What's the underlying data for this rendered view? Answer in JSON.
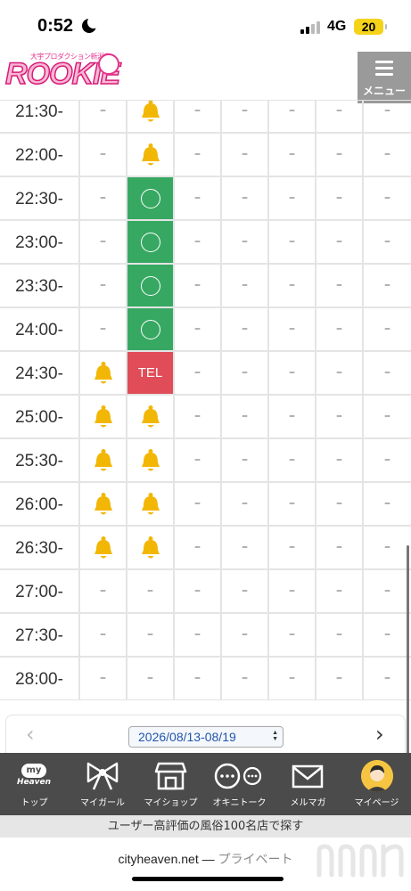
{
  "status_bar": {
    "time": "0:52",
    "network": "4G",
    "battery": "20"
  },
  "header": {
    "logo_text": "ROOKIE",
    "logo_sub": "大宇プロダクション新潟店",
    "menu_label": "メニュー"
  },
  "schedule": {
    "rows": [
      {
        "time": "21:30-",
        "cells": [
          "dash",
          "bell",
          "dash",
          "dash",
          "dash",
          "dash",
          "dash"
        ]
      },
      {
        "time": "22:00-",
        "cells": [
          "dash",
          "bell",
          "dash",
          "dash",
          "dash",
          "dash",
          "dash"
        ]
      },
      {
        "time": "22:30-",
        "cells": [
          "dash",
          "ok",
          "dash",
          "dash",
          "dash",
          "dash",
          "dash"
        ]
      },
      {
        "time": "23:00-",
        "cells": [
          "dash",
          "ok",
          "dash",
          "dash",
          "dash",
          "dash",
          "dash"
        ]
      },
      {
        "time": "23:30-",
        "cells": [
          "dash",
          "ok",
          "dash",
          "dash",
          "dash",
          "dash",
          "dash"
        ]
      },
      {
        "time": "24:00-",
        "cells": [
          "dash",
          "ok",
          "dash",
          "dash",
          "dash",
          "dash",
          "dash"
        ]
      },
      {
        "time": "24:30-",
        "cells": [
          "bell",
          "tel",
          "dash",
          "dash",
          "dash",
          "dash",
          "dash"
        ]
      },
      {
        "time": "25:00-",
        "cells": [
          "bell",
          "bell",
          "dash",
          "dash",
          "dash",
          "dash",
          "dash"
        ]
      },
      {
        "time": "25:30-",
        "cells": [
          "bell",
          "bell",
          "dash",
          "dash",
          "dash",
          "dash",
          "dash"
        ]
      },
      {
        "time": "26:00-",
        "cells": [
          "bell",
          "bell",
          "dash",
          "dash",
          "dash",
          "dash",
          "dash"
        ]
      },
      {
        "time": "26:30-",
        "cells": [
          "bell",
          "bell",
          "dash",
          "dash",
          "dash",
          "dash",
          "dash"
        ]
      },
      {
        "time": "27:00-",
        "cells": [
          "dash",
          "dash",
          "dash",
          "dash",
          "dash",
          "dash",
          "dash"
        ]
      },
      {
        "time": "27:30-",
        "cells": [
          "dash",
          "dash",
          "dash",
          "dash",
          "dash",
          "dash",
          "dash"
        ]
      },
      {
        "time": "28:00-",
        "cells": [
          "dash",
          "dash",
          "dash",
          "dash",
          "dash",
          "dash",
          "dash"
        ]
      }
    ],
    "dash_text": "–",
    "tel_text": "TEL",
    "icons": {
      "dash": "dash",
      "bell": "bell-icon",
      "ok": "circle-icon",
      "tel": "tel-label"
    },
    "colors": {
      "ok": "#37a862",
      "tel": "#e04c57",
      "bell": "#f2b705"
    }
  },
  "week_nav": {
    "prev": "‹",
    "next": "›",
    "selected_week": "2026/08/13-08/19"
  },
  "bottom_nav": {
    "items": [
      {
        "id": "top",
        "label": "トップ",
        "badge_top": "my",
        "badge_bottom": "Heaven",
        "icon": "my-heaven-icon"
      },
      {
        "id": "my-girl",
        "label": "マイガール",
        "icon": "ribbon-icon"
      },
      {
        "id": "my-shop",
        "label": "マイショップ",
        "icon": "shop-icon"
      },
      {
        "id": "okini-talk",
        "label": "オキニトーク",
        "icon": "chat-bubbles-icon"
      },
      {
        "id": "mail-magazine",
        "label": "メルマガ",
        "icon": "envelope-icon"
      },
      {
        "id": "my-page",
        "label": "マイページ",
        "icon": "avatar-icon"
      }
    ]
  },
  "promo_text": "ユーザー高評価の風俗100名店で探す",
  "url_bar": {
    "domain": "cityheaven.net",
    "separator": " — ",
    "mode": "プライベート"
  }
}
